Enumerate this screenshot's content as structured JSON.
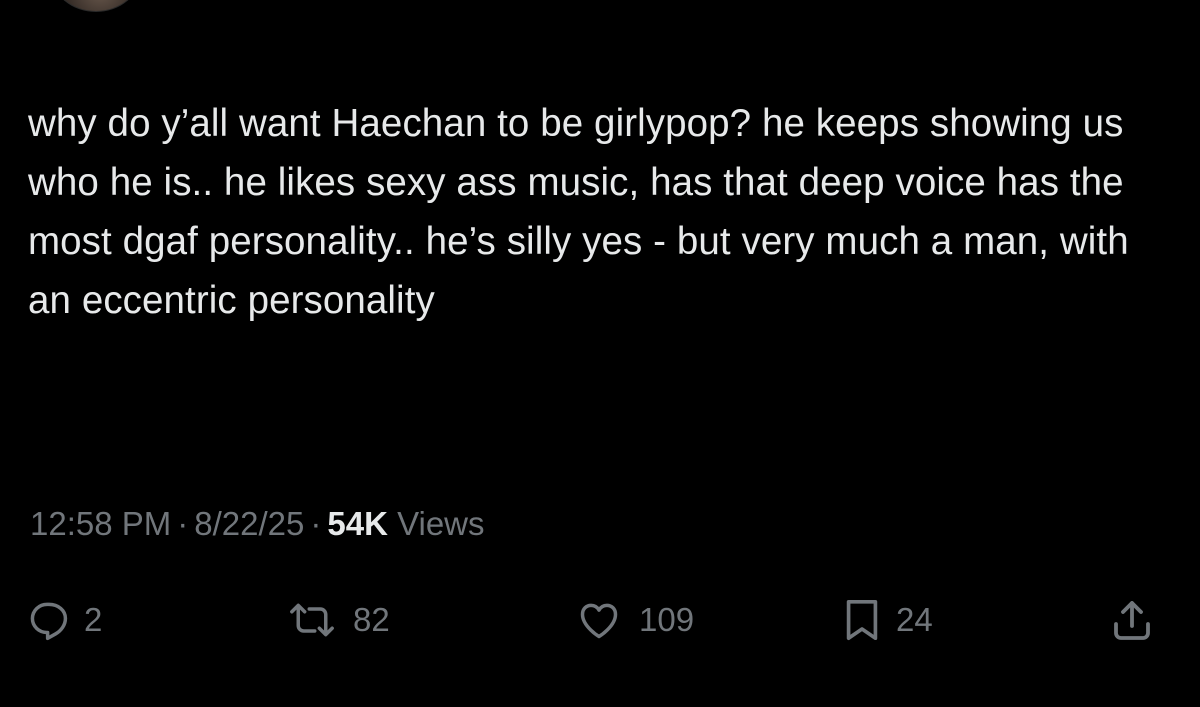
{
  "tweet": {
    "text": "why do y’all want Haechan to be girlypop? he keeps showing us who he is.. he likes sexy ass music, has that deep voice has the most dgaf personality.. he’s silly yes - but very much a man, with an eccentric personality",
    "time": "12:58 PM",
    "date": "8/22/25",
    "separator": "·",
    "views_count": "54K",
    "views_label": "Views"
  },
  "actions": {
    "replies": {
      "icon": "reply-icon",
      "count": "2"
    },
    "reposts": {
      "icon": "repost-icon",
      "count": "82"
    },
    "likes": {
      "icon": "heart-icon",
      "count": "109"
    },
    "bookmarks": {
      "icon": "bookmark-icon",
      "count": "24"
    },
    "share": {
      "icon": "share-icon"
    }
  },
  "colors": {
    "background": "#000000",
    "text": "#e7e9ea",
    "muted": "#71767b"
  }
}
